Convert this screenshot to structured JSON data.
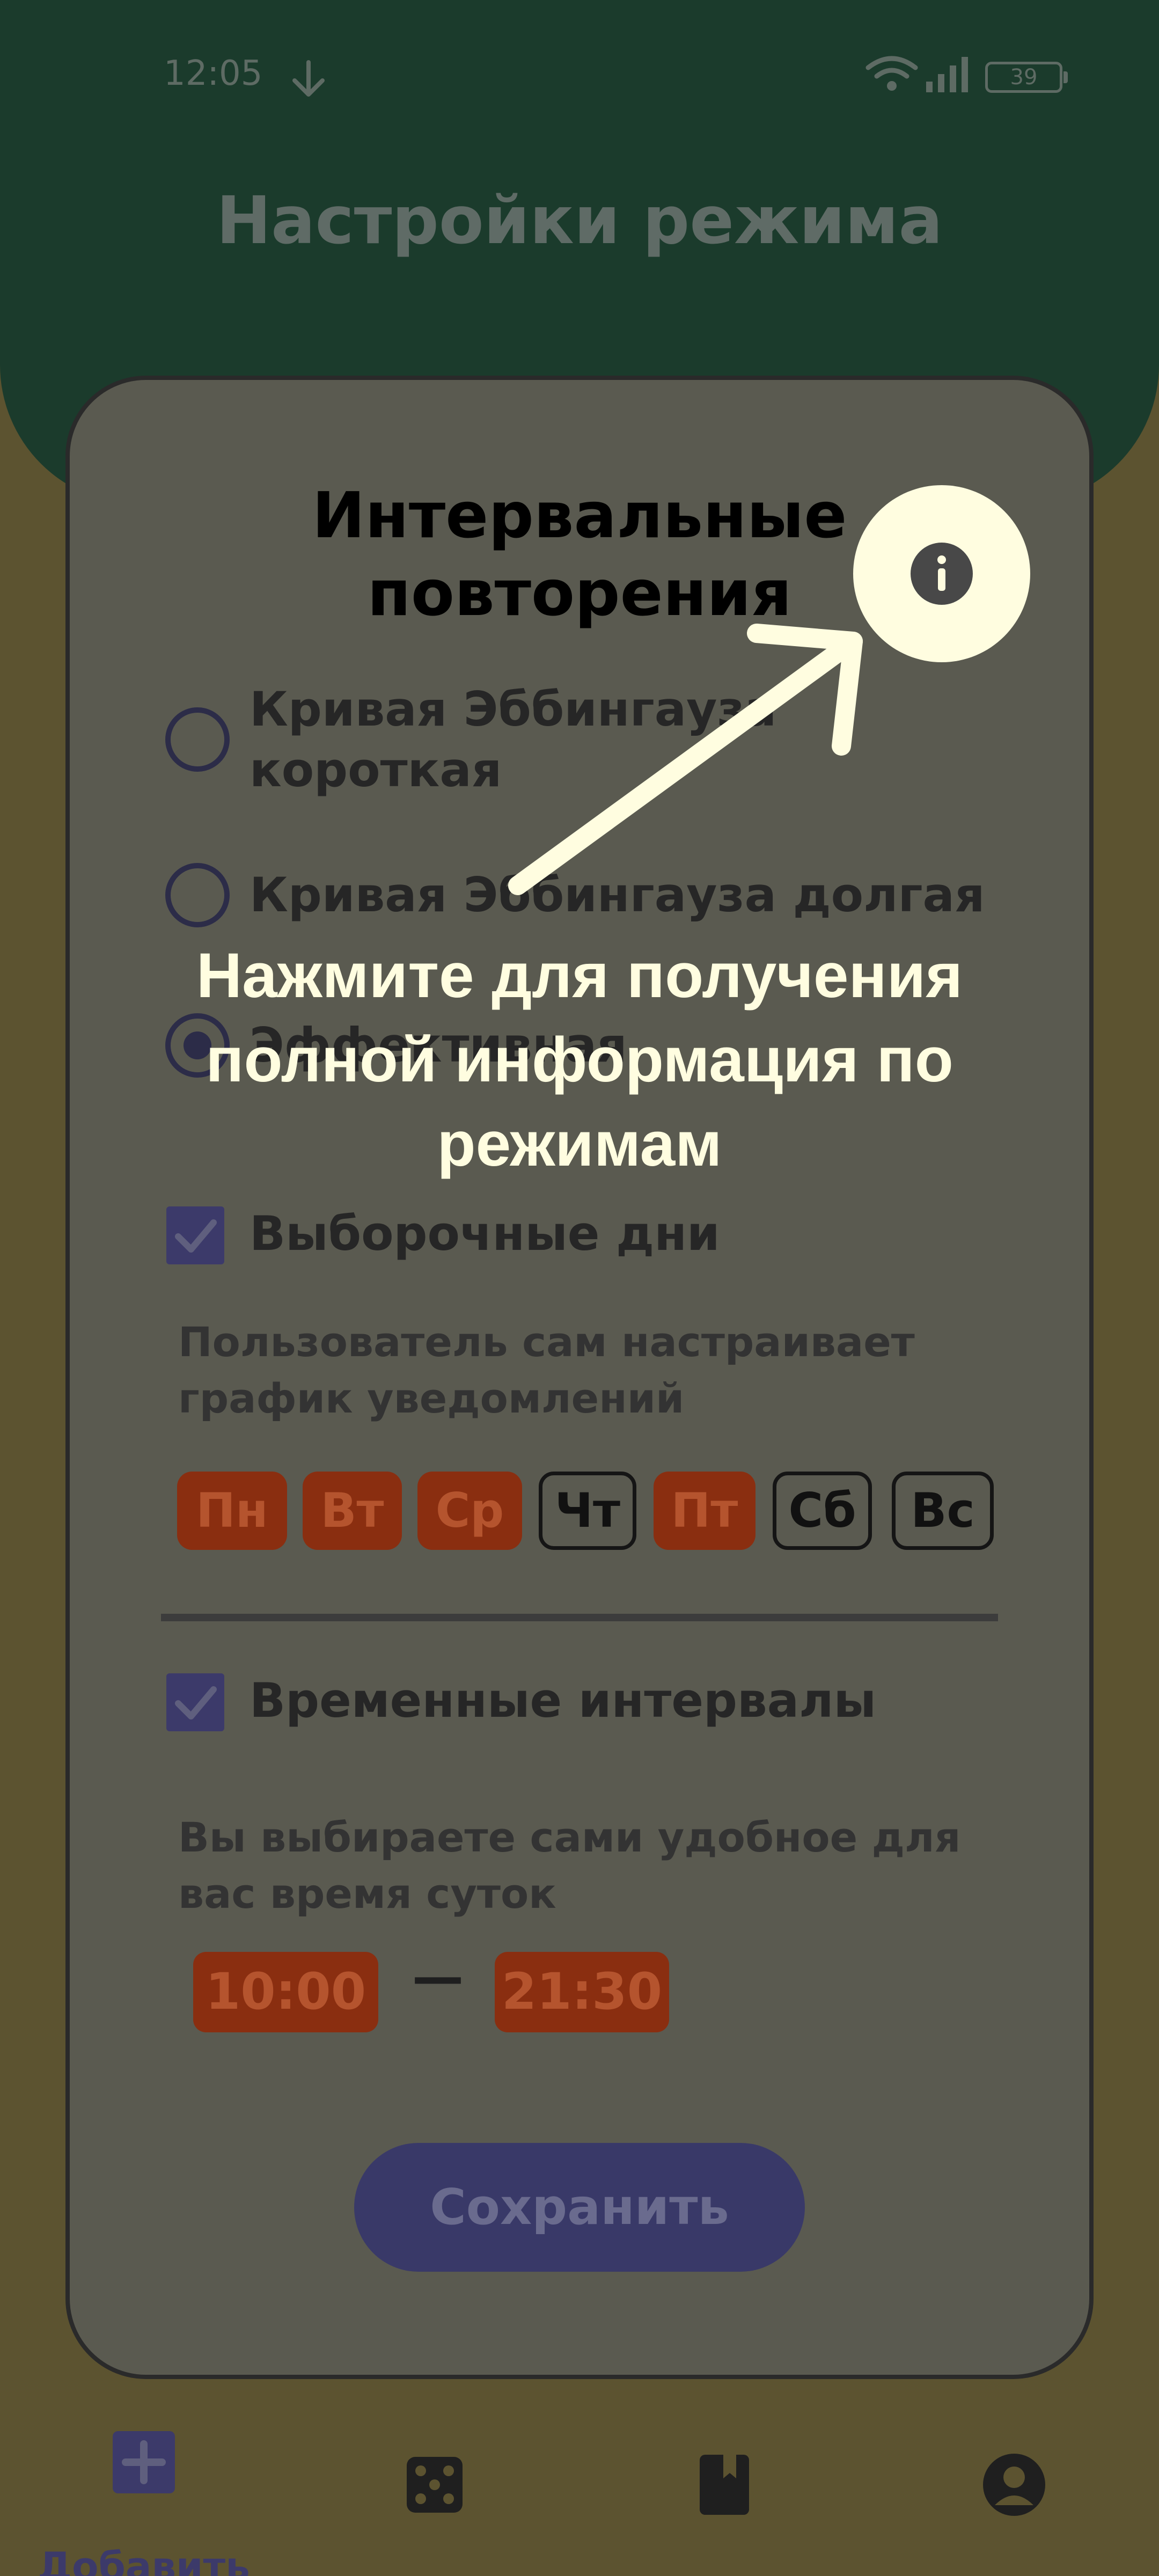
{
  "status_bar": {
    "time": "12:05",
    "battery": "39",
    "icons": [
      "download-icon",
      "wifi-icon",
      "signal-icon",
      "battery-icon"
    ]
  },
  "header": {
    "title": "Настройки режима"
  },
  "card": {
    "title_line1": "Интервальные",
    "title_line2": "повторения",
    "options": [
      {
        "label_line1": "Кривая Эббингауза",
        "label_line2": "короткая",
        "selected": false
      },
      {
        "label_line1": "Кривая Эббингауза долгая",
        "label_line2": "",
        "selected": false
      },
      {
        "label_line1": "Эффективная",
        "label_line2": "",
        "selected": true
      }
    ],
    "selective_days": {
      "checked": true,
      "label": "Выборочные дни",
      "desc_line1": "Пользователь сам настраивает",
      "desc_line2": "график уведомлений",
      "days": [
        {
          "label": "Пн",
          "active": true
        },
        {
          "label": "Вт",
          "active": true
        },
        {
          "label": "Ср",
          "active": true
        },
        {
          "label": "Чт",
          "active": false
        },
        {
          "label": "Пт",
          "active": true
        },
        {
          "label": "Сб",
          "active": false
        },
        {
          "label": "Вс",
          "active": false
        }
      ]
    },
    "time_intervals": {
      "checked": true,
      "label": "Временные интервалы",
      "desc_line1": "Вы выбираете сами удобное для",
      "desc_line2": "вас время суток",
      "start": "10:00",
      "dash": "—",
      "end": "21:30"
    },
    "save_label": "Сохранить"
  },
  "tooltip": {
    "text_line1": "Нажмите для получения",
    "text_line2": "полной информация по",
    "text_line3": "режимам",
    "target_icon": "info-icon"
  },
  "bottom_nav": {
    "items": [
      {
        "label": "Добавить",
        "icon": "plus-icon",
        "active": true
      },
      {
        "label": "",
        "icon": "dice-icon",
        "active": false
      },
      {
        "label": "",
        "icon": "book-icon",
        "active": false
      },
      {
        "label": "",
        "icon": "profile-icon",
        "active": false
      }
    ]
  },
  "colors": {
    "header_bg": "#1b3b2c",
    "page_bg": "#5c5330",
    "card_bg": "#5a5a50",
    "accent_red": "#8a2e10",
    "accent_blue": "#3c3a6a",
    "highlight": "#fffde0"
  }
}
